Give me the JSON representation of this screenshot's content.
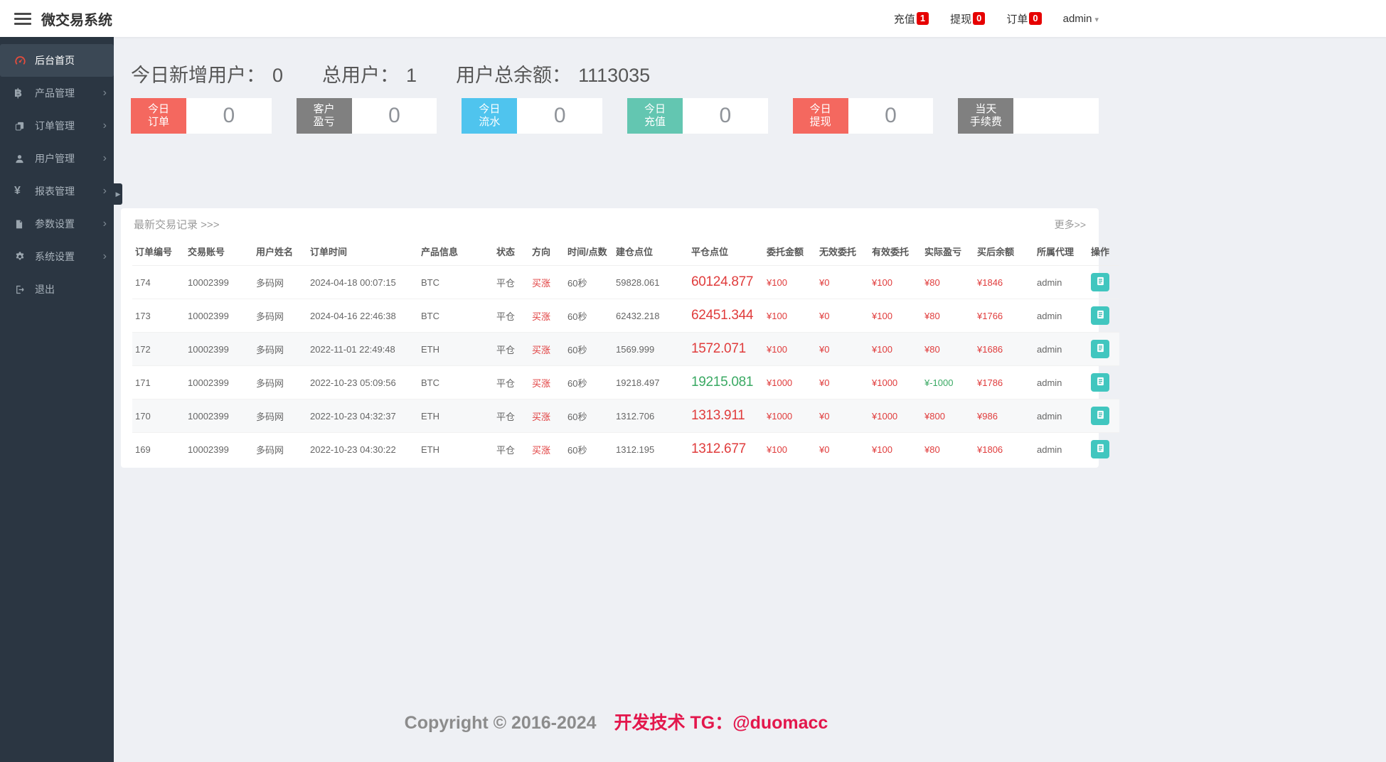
{
  "header": {
    "title": "微交易系统",
    "nav": [
      {
        "key": "recharge",
        "label": "充值",
        "badge": "1"
      },
      {
        "key": "withdraw",
        "label": "提现",
        "badge": "0"
      },
      {
        "key": "order",
        "label": "订单",
        "badge": "0"
      }
    ],
    "user": "admin"
  },
  "sidebar": {
    "items": [
      {
        "key": "home",
        "label": "后台首页",
        "icon": "dashboard-icon",
        "active": true,
        "arrow": false
      },
      {
        "key": "products",
        "label": "产品管理",
        "icon": "bitcoin-icon",
        "active": false,
        "arrow": true
      },
      {
        "key": "orders",
        "label": "订单管理",
        "icon": "copy-icon",
        "active": false,
        "arrow": true
      },
      {
        "key": "users",
        "label": "用户管理",
        "icon": "user-icon",
        "active": false,
        "arrow": true
      },
      {
        "key": "reports",
        "label": "报表管理",
        "icon": "yen-icon",
        "active": false,
        "arrow": true
      },
      {
        "key": "params",
        "label": "参数设置",
        "icon": "file-icon",
        "active": false,
        "arrow": true
      },
      {
        "key": "system",
        "label": "系统设置",
        "icon": "gear-icon",
        "active": false,
        "arrow": true
      },
      {
        "key": "logout",
        "label": "退出",
        "icon": "logout-icon",
        "active": false,
        "arrow": false
      }
    ]
  },
  "stats": {
    "summary": [
      {
        "label": "今日新增用户：",
        "value": "0"
      },
      {
        "label": "总用户：",
        "value": "1"
      },
      {
        "label": "用户总余额：",
        "value": "1113035"
      }
    ],
    "cards": [
      {
        "key": "today-orders",
        "label": "今日\n订单",
        "value": "0",
        "color": "#f4685f"
      },
      {
        "key": "customer-pnl",
        "label": "客户\n盈亏",
        "value": "0",
        "color": "#808080"
      },
      {
        "key": "today-flow",
        "label": "今日\n流水",
        "value": "0",
        "color": "#4fc4ee"
      },
      {
        "key": "today-recharge",
        "label": "今日\n充值",
        "value": "0",
        "color": "#63c6b1"
      },
      {
        "key": "today-withdraw",
        "label": "今日\n提现",
        "value": "0",
        "color": "#f4685f"
      },
      {
        "key": "today-fee",
        "label": "当天\n手续费",
        "value": "",
        "color": "#808080"
      }
    ]
  },
  "table": {
    "title": "最新交易记录 >>>",
    "more": "更多>>",
    "action_icon": "list-icon",
    "columns": [
      "订单编号",
      "交易账号",
      "用户姓名",
      "订单时间",
      "产品信息",
      "状态",
      "方向",
      "时间/点数",
      "建仓点位",
      "平仓点位",
      "委托金额",
      "无效委托",
      "有效委托",
      "实际盈亏",
      "买后余额",
      "所属代理",
      "操作"
    ],
    "rows": [
      {
        "id": "174",
        "account": "10002399",
        "name": "多码网",
        "time": "2024-04-18 00:07:15",
        "product": "BTC",
        "status": "平仓",
        "direction": "买涨",
        "duration": "60秒",
        "open": "59828.061",
        "close": "60124.877",
        "close_color": "red",
        "amount": "¥100",
        "invalid": "¥0",
        "valid": "¥100",
        "profit": "¥80",
        "profit_color": "red",
        "balance": "¥1846",
        "agent": "admin",
        "shaded": false
      },
      {
        "id": "173",
        "account": "10002399",
        "name": "多码网",
        "time": "2024-04-16 22:46:38",
        "product": "BTC",
        "status": "平仓",
        "direction": "买涨",
        "duration": "60秒",
        "open": "62432.218",
        "close": "62451.344",
        "close_color": "red",
        "amount": "¥100",
        "invalid": "¥0",
        "valid": "¥100",
        "profit": "¥80",
        "profit_color": "red",
        "balance": "¥1766",
        "agent": "admin",
        "shaded": false
      },
      {
        "id": "172",
        "account": "10002399",
        "name": "多码网",
        "time": "2022-11-01 22:49:48",
        "product": "ETH",
        "status": "平仓",
        "direction": "买涨",
        "duration": "60秒",
        "open": "1569.999",
        "close": "1572.071",
        "close_color": "red",
        "amount": "¥100",
        "invalid": "¥0",
        "valid": "¥100",
        "profit": "¥80",
        "profit_color": "red",
        "balance": "¥1686",
        "agent": "admin",
        "shaded": true
      },
      {
        "id": "171",
        "account": "10002399",
        "name": "多码网",
        "time": "2022-10-23 05:09:56",
        "product": "BTC",
        "status": "平仓",
        "direction": "买涨",
        "duration": "60秒",
        "open": "19218.497",
        "close": "19215.081",
        "close_color": "green",
        "amount": "¥1000",
        "invalid": "¥0",
        "valid": "¥1000",
        "profit": "¥-1000",
        "profit_color": "green",
        "balance": "¥1786",
        "agent": "admin",
        "shaded": false
      },
      {
        "id": "170",
        "account": "10002399",
        "name": "多码网",
        "time": "2022-10-23 04:32:37",
        "product": "ETH",
        "status": "平仓",
        "direction": "买涨",
        "duration": "60秒",
        "open": "1312.706",
        "close": "1313.911",
        "close_color": "red",
        "amount": "¥1000",
        "invalid": "¥0",
        "valid": "¥1000",
        "profit": "¥800",
        "profit_color": "red",
        "balance": "¥986",
        "agent": "admin",
        "shaded": true
      },
      {
        "id": "169",
        "account": "10002399",
        "name": "多码网",
        "time": "2022-10-23 04:30:22",
        "product": "ETH",
        "status": "平仓",
        "direction": "买涨",
        "duration": "60秒",
        "open": "1312.195",
        "close": "1312.677",
        "close_color": "red",
        "amount": "¥100",
        "invalid": "¥0",
        "valid": "¥100",
        "profit": "¥80",
        "profit_color": "red",
        "balance": "¥1806",
        "agent": "admin",
        "shaded": false
      }
    ]
  },
  "footer": {
    "copyright": "Copyright © 2016-2024",
    "dev": "开发技术 TG：@duomacc"
  },
  "colors": {
    "badge_red": "#e60000",
    "sidebar_bg": "#2b3642",
    "sidebar_active_bg": "#3b4855",
    "page_bg": "#eef0f4",
    "text_red": "#e03c3c",
    "text_green": "#3aa963",
    "action_teal": "#41c6bf",
    "footer_dev": "#e3174c"
  }
}
